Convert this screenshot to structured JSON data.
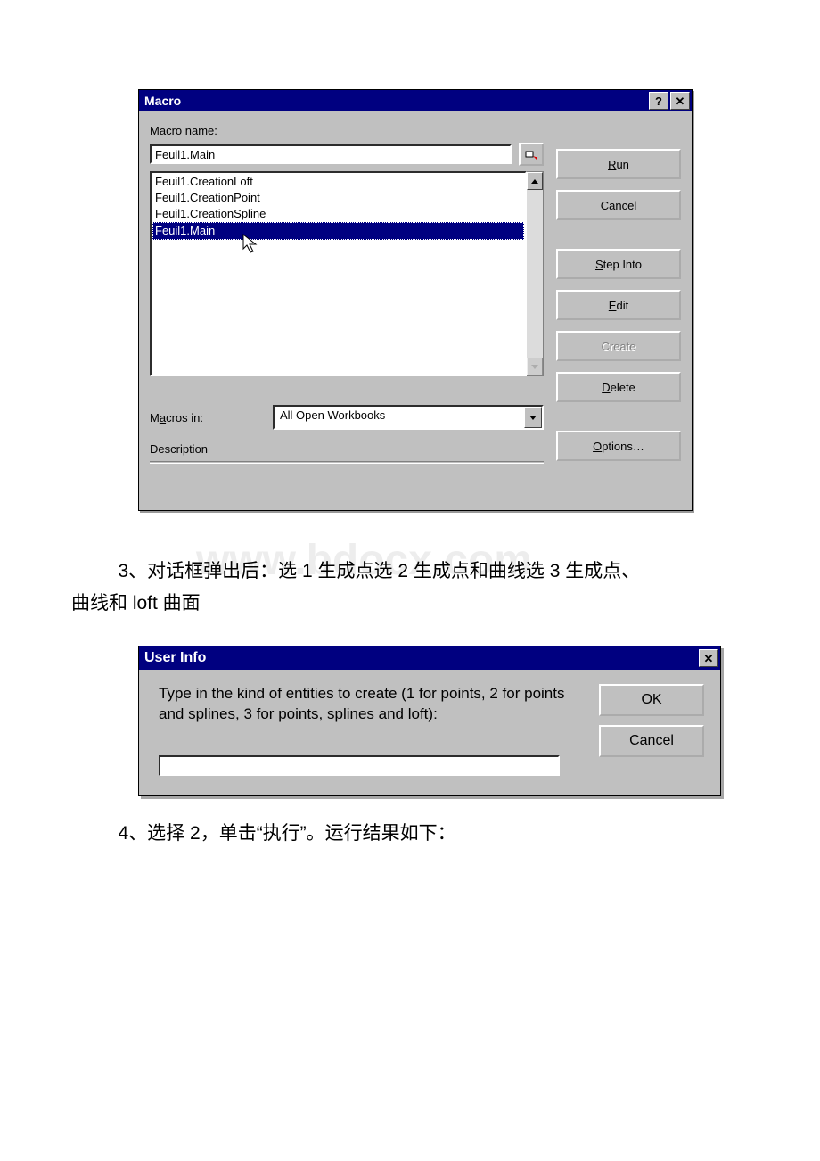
{
  "macro_dialog": {
    "title": "Macro",
    "macro_name_label_pre": "M",
    "macro_name_label_post": "acro name:",
    "macro_name_value": "Feuil1.Main",
    "list_items": [
      "Feuil1.CreationLoft",
      "Feuil1.CreationPoint",
      "Feuil1.CreationSpline",
      "Feuil1.Main"
    ],
    "selected_index": 3,
    "macros_in_label_pre": "M",
    "macros_in_label_ul": "a",
    "macros_in_label_post": "cros in:",
    "macros_in_value": "All Open Workbooks",
    "description_label": "Description",
    "buttons": {
      "run": "Run",
      "run_ul": "R",
      "cancel": "Cancel",
      "step_into": "Step Into",
      "step_ul": "S",
      "edit": "Edit",
      "edit_ul": "E",
      "create": "Create",
      "delete": "Delete",
      "delete_ul": "D",
      "options": "Options…",
      "options_ul": "O"
    }
  },
  "body_text_1_a": "3、对话框弹出后：选 1 生成点选 2 生成点和曲线选 3 生成点、",
  "body_text_1_b": "曲线和 loft 曲面",
  "watermark": "www.bdocx.com",
  "user_info_dialog": {
    "title": "User Info",
    "prompt": "Type in the kind of entities to create (1 for points, 2 for points and splines, 3 for points, splines and loft):",
    "ok": "OK",
    "cancel": "Cancel",
    "input_value": ""
  },
  "body_text_2": "4、选择 2，单击“执行”。运行结果如下："
}
